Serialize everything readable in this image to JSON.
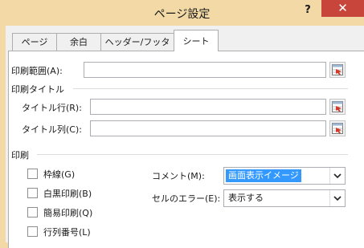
{
  "window": {
    "title": "ページ設定",
    "help": "?",
    "close": "✕"
  },
  "tabs": [
    {
      "label": "ページ",
      "active": false
    },
    {
      "label": "余白",
      "active": false
    },
    {
      "label": "ヘッダー/フッター",
      "active": false
    },
    {
      "label": "シート",
      "active": true
    }
  ],
  "print_area": {
    "label": "印刷範囲(A):",
    "value": ""
  },
  "print_titles": {
    "section": "印刷タイトル",
    "rows_label": "タイトル行(R):",
    "rows_value": "",
    "cols_label": "タイトル列(C):",
    "cols_value": ""
  },
  "print": {
    "section": "印刷",
    "checkboxes": [
      {
        "label": "枠線(G)",
        "checked": false
      },
      {
        "label": "白黒印刷(B)",
        "checked": false
      },
      {
        "label": "簡易印刷(Q)",
        "checked": false
      },
      {
        "label": "行列番号(L)",
        "checked": false
      }
    ],
    "comments_label": "コメント(M):",
    "comments_value": "画面表示イメージ",
    "errors_label": "セルのエラー(E):",
    "errors_value": "表示する"
  },
  "colors": {
    "titlebar": "#f2d9a6",
    "close": "#c7453b",
    "selection": "#3399ff"
  }
}
